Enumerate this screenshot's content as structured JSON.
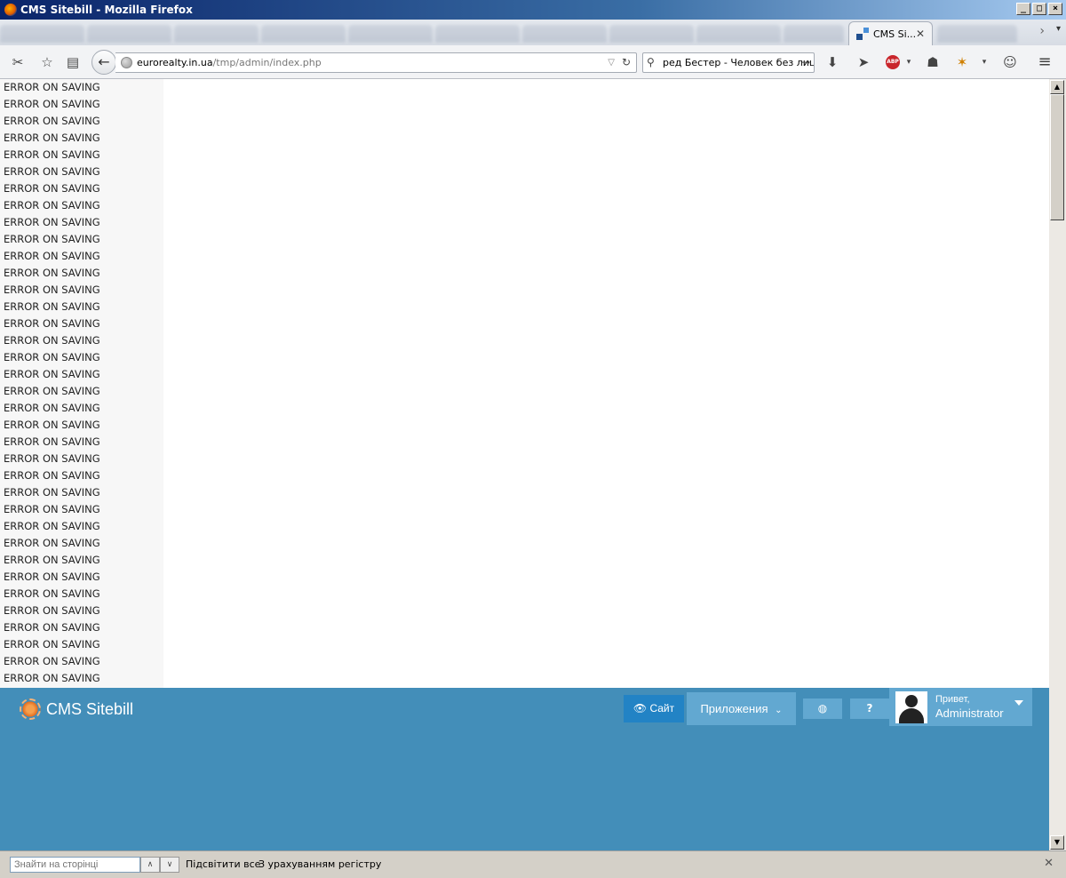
{
  "window": {
    "title": "CMS Sitebill - Mozilla Firefox"
  },
  "tab": {
    "title": "CMS Si..."
  },
  "url": {
    "domain": "eurorealty.in.ua",
    "path": "/tmp/admin/index.php"
  },
  "search": {
    "value": "ред Бестер - Человек без лица"
  },
  "log": {
    "lines": [
      "ERROR ON SAVING",
      "ERROR ON SAVING",
      "ERROR ON SAVING",
      "ERROR ON SAVING",
      "ERROR ON SAVING",
      "ERROR ON SAVING",
      "ERROR ON SAVING",
      "ERROR ON SAVING",
      "ERROR ON SAVING",
      "ERROR ON SAVING",
      "ERROR ON SAVING",
      "ERROR ON SAVING",
      "ERROR ON SAVING",
      "ERROR ON SAVING",
      "ERROR ON SAVING",
      "ERROR ON SAVING",
      "ERROR ON SAVING",
      "ERROR ON SAVING",
      "ERROR ON SAVING",
      "ERROR ON SAVING",
      "ERROR ON SAVING",
      "ERROR ON SAVING",
      "ERROR ON SAVING",
      "ERROR ON SAVING",
      "ERROR ON SAVING",
      "ERROR ON SAVING",
      "ERROR ON SAVING",
      "ERROR ON SAVING",
      "ERROR ON SAVING",
      "ERROR ON SAVING",
      "ERROR ON SAVING",
      "ERROR ON SAVING",
      "ERROR ON SAVING",
      "ERROR ON SAVING",
      "ERROR ON SAVING",
      "ERROR ON SAVING"
    ]
  },
  "cms": {
    "brand": "CMS Sitebill",
    "site_button": "Сайт",
    "apps_button": "Приложения",
    "user_greeting": "Привет,",
    "user_name": "Administrator"
  },
  "findbar": {
    "placeholder": "Знайти на сторінці",
    "highlight_all": "Підсвітити все",
    "match_case": "З урахуванням регістру"
  }
}
